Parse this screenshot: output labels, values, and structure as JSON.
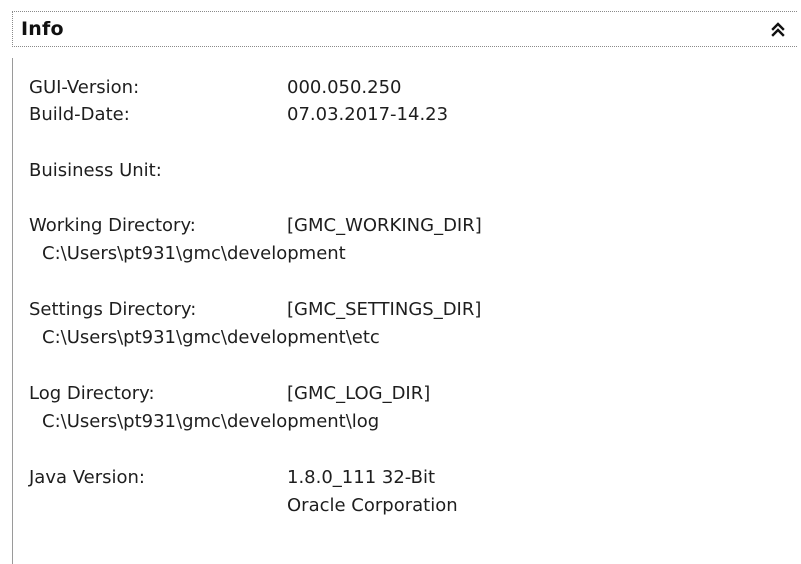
{
  "panel": {
    "title": "Info",
    "collapse_icon": "double-chevron-up-icon"
  },
  "info": {
    "gui_version": {
      "label": "GUI-Version:",
      "value": "000.050.250"
    },
    "build_date": {
      "label": "Build-Date:",
      "value": "07.03.2017-14.23"
    },
    "business_unit": {
      "label": "Buisiness Unit:"
    },
    "working_directory": {
      "label": "Working Directory:",
      "variable": "[GMC_WORKING_DIR]",
      "path": "C:\\Users\\pt931\\gmc\\development"
    },
    "settings_directory": {
      "label": "Settings Directory:",
      "variable": "[GMC_SETTINGS_DIR]",
      "path": "C:\\Users\\pt931\\gmc\\development\\etc"
    },
    "log_directory": {
      "label": "Log Directory:",
      "variable": "[GMC_LOG_DIR]",
      "path": "C:\\Users\\pt931\\gmc\\development\\log"
    },
    "java_version": {
      "label": "Java Version:",
      "version": "1.8.0_111 32-Bit",
      "vendor": "Oracle Corporation"
    }
  }
}
